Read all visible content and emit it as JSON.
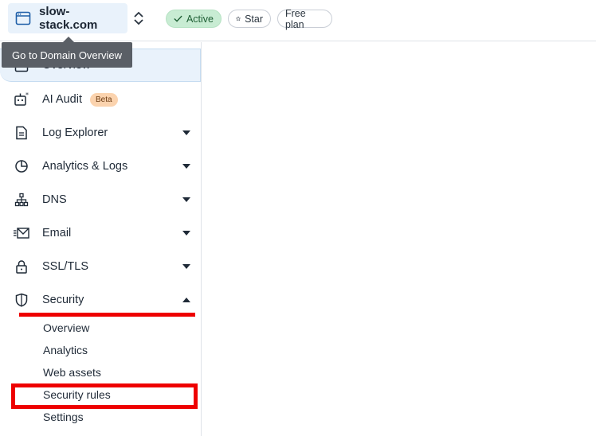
{
  "topbar": {
    "domain": "slow-stack.com",
    "status": "Active",
    "star_label": "Star",
    "plan": "Free plan"
  },
  "tooltip": {
    "text": "Go to Domain Overview"
  },
  "sidebar": {
    "items": [
      {
        "label": "Overview",
        "icon": "window-icon"
      },
      {
        "label": "AI Audit",
        "icon": "robot-icon",
        "badge": "Beta"
      },
      {
        "label": "Log Explorer",
        "icon": "document-icon",
        "expanded": false
      },
      {
        "label": "Analytics & Logs",
        "icon": "pie-chart-icon",
        "expanded": false
      },
      {
        "label": "DNS",
        "icon": "network-icon",
        "expanded": false
      },
      {
        "label": "Email",
        "icon": "envelope-icon",
        "expanded": false
      },
      {
        "label": "SSL/TLS",
        "icon": "lock-icon",
        "expanded": false
      },
      {
        "label": "Security",
        "icon": "shield-icon",
        "expanded": true
      }
    ],
    "security_subitems": [
      "Overview",
      "Analytics",
      "Web assets",
      "Security rules",
      "Settings"
    ]
  },
  "colors": {
    "accent_bg": "#e9f2fb",
    "active_pill": "#c8ecd3",
    "beta_badge": "#fbd3ae",
    "highlight": "#ee0000"
  }
}
